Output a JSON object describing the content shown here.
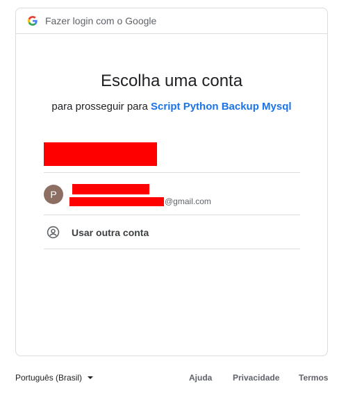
{
  "header": {
    "text": "Fazer login com o Google",
    "logo_icon": "google-g-icon"
  },
  "title": "Escolha uma conta",
  "subtitle": {
    "prefix": "para prosseguir para",
    "app_name": "Script Python Backup Mysql"
  },
  "accounts": [
    {
      "redacted": true
    },
    {
      "avatar_letter": "P",
      "avatar_color": "#8d6e63",
      "email_domain": "@gmail.com",
      "redacted_name": true,
      "redacted_email": true
    }
  ],
  "other_account": {
    "label": "Usar outra conta",
    "icon": "account-circle-icon"
  },
  "footer": {
    "language": "Português (Brasil)",
    "links": [
      "Ajuda",
      "Privacidade",
      "Termos"
    ]
  },
  "colors": {
    "link": "#1a73e8",
    "redaction": "#ff0000",
    "border": "#dadce0"
  }
}
